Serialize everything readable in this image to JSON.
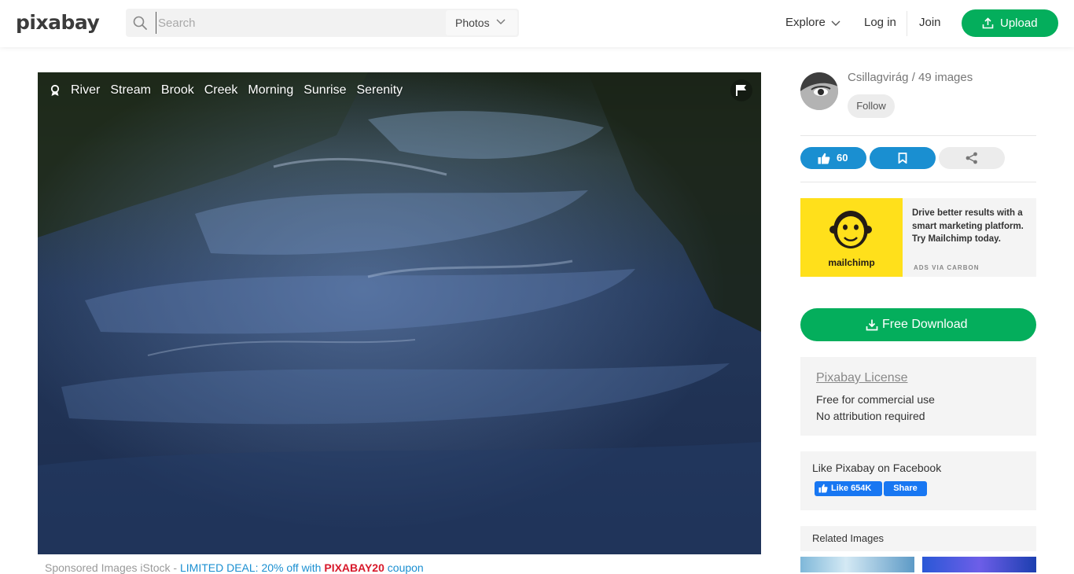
{
  "header": {
    "logo": "pixabay",
    "search_placeholder": "Search",
    "search_type": "Photos",
    "nav_explore": "Explore",
    "nav_login": "Log in",
    "nav_join": "Join",
    "upload_label": "Upload"
  },
  "photo": {
    "tags": [
      "River",
      "Stream",
      "Brook",
      "Creek",
      "Morning",
      "Sunrise",
      "Serenity"
    ]
  },
  "sponsored": {
    "prefix": "Sponsored Images iStock - ",
    "deal": "LIMITED DEAL: 20% off with ",
    "code": "PIXABAY20",
    "suffix": " coupon"
  },
  "sidebar": {
    "author": "Csillagvirág / 49 images",
    "follow_label": "Follow",
    "like_count": "60",
    "ad": {
      "brand": "mailchimp",
      "text": "Drive better results with a smart marketing platform. Try Mailchimp today.",
      "via": "ADS VIA CARBON"
    },
    "download_label": "Free Download",
    "license": {
      "title": "Pixabay License",
      "line1": "Free for commercial use",
      "line2": "No attribution required"
    },
    "facebook": {
      "title": "Like Pixabay on Facebook",
      "like_label": "Like 654K",
      "share_label": "Share"
    },
    "related_title": "Related Images"
  },
  "colors": {
    "accent_green": "#04ae5c",
    "accent_blue": "#1a8fd1",
    "facebook_blue": "#1877f2",
    "ad_yellow": "#ffe01b",
    "deal_blue": "#1a8fd1",
    "coupon_red": "#d8192b"
  },
  "icons": [
    "search-icon",
    "chevron-down-icon",
    "upload-icon",
    "award-icon",
    "flag-icon",
    "thumbs-up-icon",
    "bookmark-icon",
    "share-icon",
    "download-icon",
    "facebook-thumb-icon",
    "mailchimp-logo"
  ]
}
